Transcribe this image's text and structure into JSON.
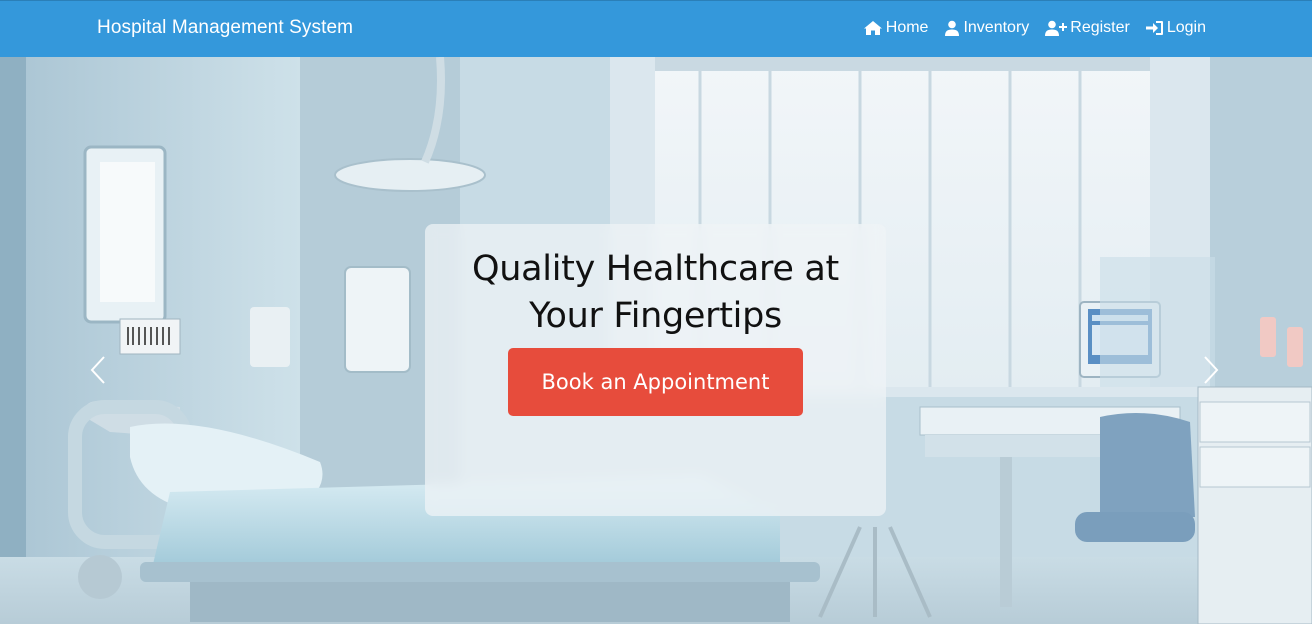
{
  "navbar": {
    "brand": "Hospital Management System",
    "links": [
      {
        "label": "Home",
        "icon": "home-icon"
      },
      {
        "label": "Inventory",
        "icon": "user-icon"
      },
      {
        "label": "Register",
        "icon": "user-plus-icon"
      },
      {
        "label": "Login",
        "icon": "sign-in-icon"
      }
    ]
  },
  "hero": {
    "headline_line1": "Quality Healthcare at",
    "headline_line2": "Your Fingertips",
    "cta_label": "Book an Appointment",
    "prev_icon": "chevron-left-icon",
    "next_icon": "chevron-right-icon"
  },
  "colors": {
    "navbar_bg": "#3498db",
    "cta_bg": "#e74c3c",
    "text_on_accent": "#ffffff",
    "headline_text": "#111111"
  }
}
